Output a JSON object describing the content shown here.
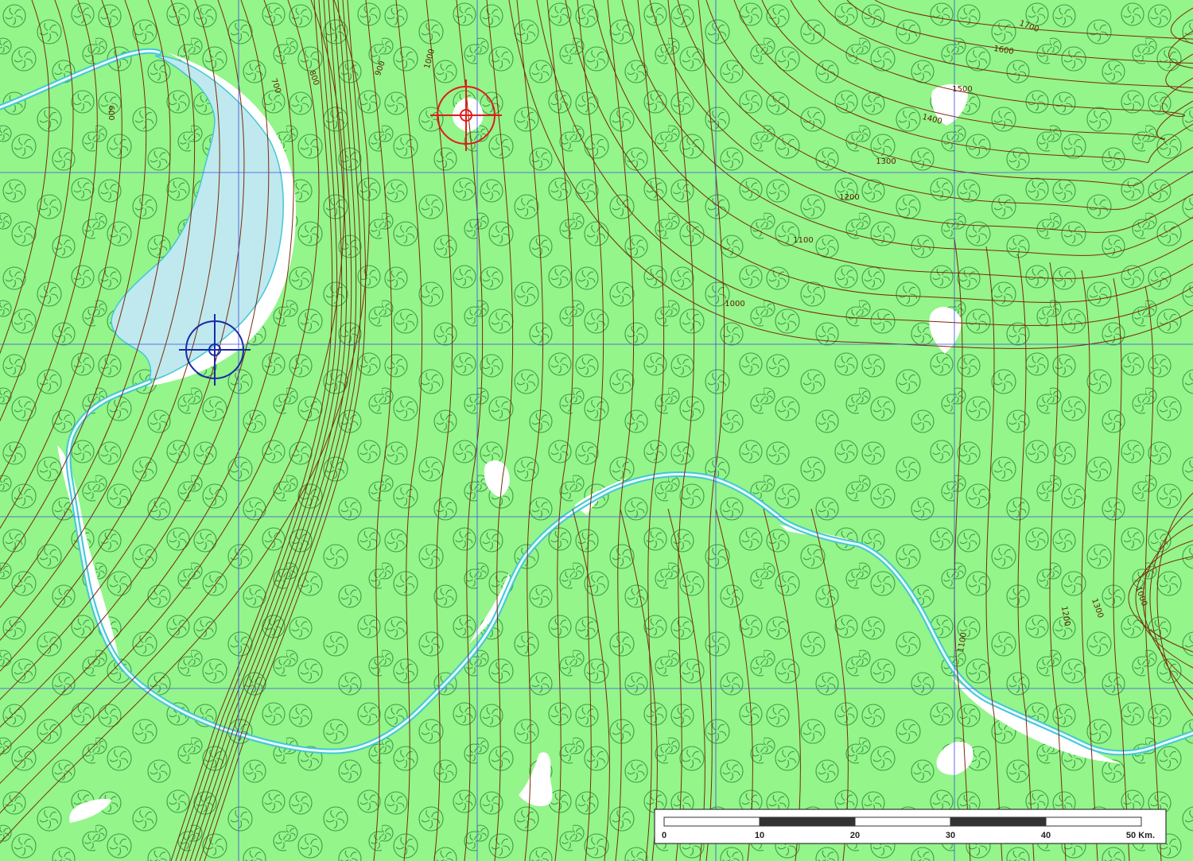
{
  "map": {
    "colors": {
      "forest": "#93f58a",
      "tree_symbol": "#3e9a46",
      "contour": "#7a2a08",
      "grid": "#3f4be0",
      "water": "#bfe9ee",
      "water_edge": "#45c6d6",
      "clearing": "#ffffff",
      "friendly_marker": "#1a2aa8",
      "target_marker": "#e01c1c"
    },
    "icons": {
      "tree": "deciduous-tree-symbol",
      "friendly": "blue-crosshair-marker",
      "target": "red-crosshair-marker"
    },
    "contour_labels": [
      {
        "text": "600"
      },
      {
        "text": "700"
      },
      {
        "text": "800"
      },
      {
        "text": "900"
      },
      {
        "text": "1000"
      },
      {
        "text": "1700"
      },
      {
        "text": "1600"
      },
      {
        "text": "1500"
      },
      {
        "text": "1400"
      },
      {
        "text": "1300"
      },
      {
        "text": "1200"
      },
      {
        "text": "1100"
      },
      {
        "text": "1000"
      },
      {
        "text": "1100"
      },
      {
        "text": "1200"
      },
      {
        "text": "1300"
      },
      {
        "text": "1000"
      }
    ]
  },
  "scale_bar": {
    "labels": [
      "0",
      "10",
      "20",
      "30",
      "40",
      "50 Km."
    ]
  }
}
